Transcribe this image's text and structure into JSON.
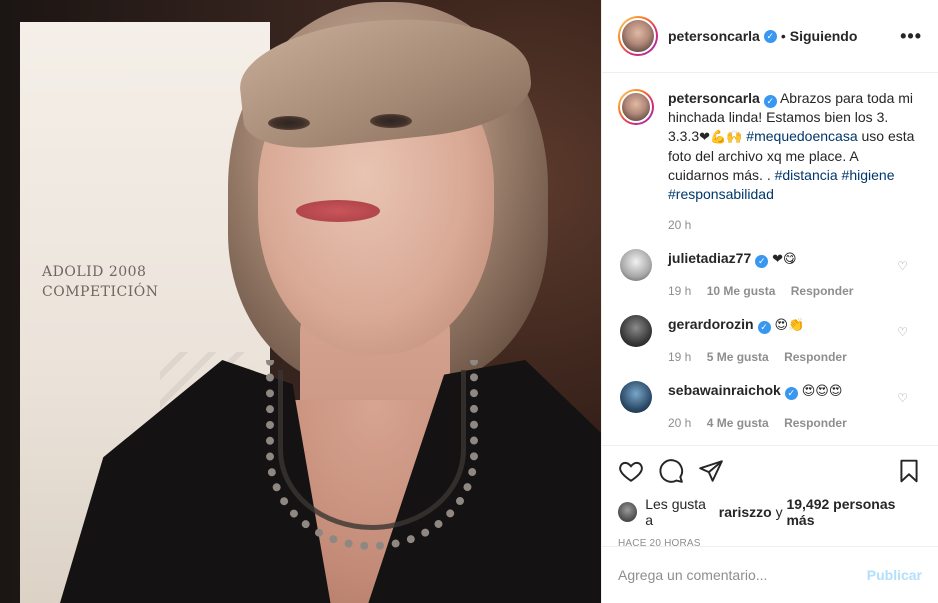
{
  "post": {
    "username": "petersoncarla",
    "follow_status": "Siguiendo",
    "separator": "•",
    "more_label": "•••"
  },
  "caption": {
    "username": "petersoncarla",
    "text_1": "Abrazos para toda mi hinchada linda! Estamos bien los 3. 3.3.3",
    "emojis_1": "❤💪🙌",
    "hashtag_1": "#mequedoencasa",
    "text_2": "uso esta foto del archivo xq me place. A cuidarnos más. .",
    "hashtag_2": "#distancia",
    "hashtag_3": "#higiene",
    "hashtag_4": "#responsabilidad",
    "time": "20 h"
  },
  "comments": [
    {
      "username": "julietadiaz77",
      "text": "❤😋",
      "time": "19 h",
      "likes": "10 Me gusta",
      "reply": "Responder"
    },
    {
      "username": "gerardorozin",
      "text": "😍👏",
      "time": "19 h",
      "likes": "5 Me gusta",
      "reply": "Responder"
    },
    {
      "username": "sebawainraichok",
      "text": "😍😍😍",
      "time": "20 h",
      "likes": "4 Me gusta",
      "reply": "Responder"
    }
  ],
  "likes": {
    "prefix": "Les gusta a",
    "user": "rariszzo",
    "connector": "y",
    "count": "19,492 personas más"
  },
  "post_time": "HACE 20 HORAS",
  "add_comment": {
    "placeholder": "Agrega un comentario...",
    "post_label": "Publicar"
  },
  "photo": {
    "banner_line_1": "ADOLID 2008",
    "banner_line_2": "COMPETICIÓN"
  },
  "icons": {
    "like": "heart-outline-icon",
    "comment": "speech-bubble-icon",
    "share": "paper-plane-icon",
    "save": "bookmark-icon"
  },
  "colors": {
    "verified": "#3897f0",
    "hashtag": "#00376b",
    "muted": "#8e8e8e",
    "post_disabled": "#b2dffc"
  }
}
